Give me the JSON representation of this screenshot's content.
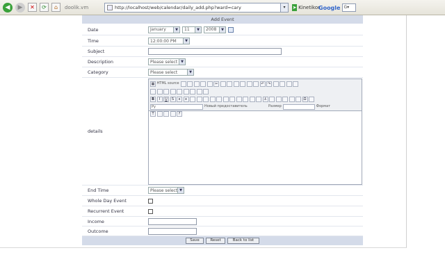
{
  "browser": {
    "site_label": "doolik.vm",
    "url": "http://localhost/web/calendar/daily_add.php?ward=cary",
    "url_end": "▾",
    "go_label": "Kinetikor",
    "google_label": "Google",
    "google_field": "G▾"
  },
  "form": {
    "title": "Add Event",
    "date": {
      "label": "Date",
      "month": "January",
      "day": "11",
      "year": "2008"
    },
    "time": {
      "label": "Time",
      "value": "12:00:00 PM"
    },
    "subject": {
      "label": "Subject",
      "value": ""
    },
    "description": {
      "label": "Description",
      "value": "Please select"
    },
    "category": {
      "label": "Category",
      "value": "Please select"
    },
    "details": {
      "label": "details"
    },
    "end_time": {
      "label": "End Time",
      "value": "Please select"
    },
    "whole_day": {
      "label": "Whole Day Event"
    },
    "recurrent": {
      "label": "Recurrent Event"
    },
    "income": {
      "label": "Income",
      "value": ""
    },
    "outcome": {
      "label": "Outcome",
      "value": ""
    },
    "buttons": {
      "save": "Save",
      "reset": "Reset",
      "back": "Back to list"
    }
  },
  "editor": {
    "toolbar_row1_label": "HTML source",
    "font_label": "Ру",
    "style_label": "Новый предоставитель",
    "size_label": "Размер",
    "format_label": "Формат"
  }
}
